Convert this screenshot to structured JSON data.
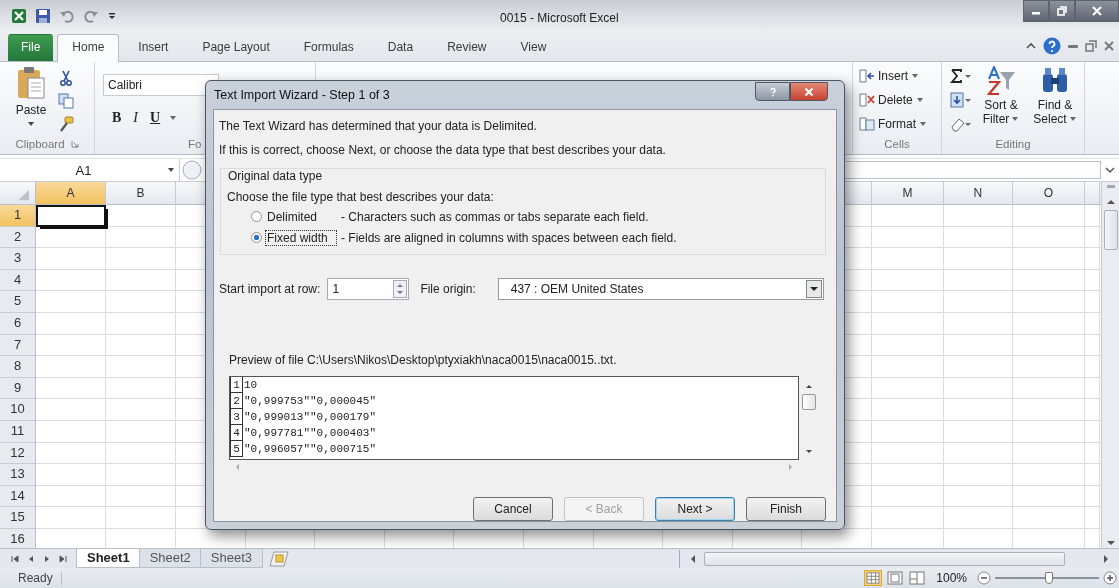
{
  "window": {
    "title": "0015 - Microsoft Excel"
  },
  "ribbon_tabs": [
    {
      "label": "File",
      "kind": "file",
      "selected": false
    },
    {
      "label": "Home",
      "kind": "tab",
      "selected": true
    },
    {
      "label": "Insert",
      "kind": "tab",
      "selected": false
    },
    {
      "label": "Page Layout",
      "kind": "tab",
      "selected": false
    },
    {
      "label": "Formulas",
      "kind": "tab",
      "selected": false
    },
    {
      "label": "Data",
      "kind": "tab",
      "selected": false
    },
    {
      "label": "Review",
      "kind": "tab",
      "selected": false
    },
    {
      "label": "View",
      "kind": "tab",
      "selected": false
    }
  ],
  "ribbon": {
    "clipboard": {
      "paste": "Paste",
      "label": "Clipboard"
    },
    "font": {
      "font_name": "Calibri",
      "bold": "B",
      "italic": "I",
      "underline": "U",
      "label": "Fo"
    },
    "cells": {
      "commands": [
        "Insert",
        "Delete",
        "Format"
      ],
      "label": "Cells"
    },
    "editing": {
      "sort": "Sort & Filter",
      "find": "Find & Select",
      "label": "Editing"
    }
  },
  "name_box": "A1",
  "sheet": {
    "columns": [
      {
        "label": "A",
        "selected": true
      },
      {
        "label": "B",
        "selected": false
      },
      {
        "label": "M",
        "selected": false
      },
      {
        "label": "N",
        "selected": false
      },
      {
        "label": "O",
        "selected": false
      }
    ],
    "rows": [
      {
        "label": "1",
        "selected": true
      },
      {
        "label": "2",
        "selected": false
      },
      {
        "label": "3",
        "selected": false
      },
      {
        "label": "4",
        "selected": false
      },
      {
        "label": "5",
        "selected": false
      },
      {
        "label": "6",
        "selected": false
      },
      {
        "label": "7",
        "selected": false
      },
      {
        "label": "8",
        "selected": false
      },
      {
        "label": "9",
        "selected": false
      },
      {
        "label": "10",
        "selected": false
      },
      {
        "label": "11",
        "selected": false
      },
      {
        "label": "12",
        "selected": false
      },
      {
        "label": "13",
        "selected": false
      },
      {
        "label": "14",
        "selected": false
      },
      {
        "label": "15",
        "selected": false
      },
      {
        "label": "16",
        "selected": false
      }
    ]
  },
  "sheet_tabs": [
    {
      "label": "Sheet1",
      "selected": true
    },
    {
      "label": "Sheet2",
      "selected": false
    },
    {
      "label": "Sheet3",
      "selected": false
    }
  ],
  "status_bar": {
    "text": "Ready",
    "zoom": "100%",
    "zoom_slider": {
      "level": 0.52
    }
  },
  "dialog": {
    "title": "Text Import Wizard - Step 1 of 3",
    "intro": [
      "The Text Wizard has determined that your data is Delimited.",
      "If this is correct, choose Next, or choose the data type that best describes your data."
    ],
    "group_title": "Original data type",
    "group_prompt": "Choose the file type that best describes your data:",
    "options": [
      {
        "label": "Delimited",
        "description": "- Characters such as commas or tabs separate each field.",
        "selected": false,
        "focused": false
      },
      {
        "label": "Fixed width",
        "description": "- Fields are aligned in columns with spaces between each field.",
        "selected": true,
        "focused": true
      }
    ],
    "start_row": {
      "label": "Start import at row:",
      "value": "1"
    },
    "file_origin": {
      "label": "File origin:",
      "value": "437 : OEM United States"
    },
    "preview": {
      "label": "Preview of file C:\\Users\\Nikos\\Desktop\\ptyxiakh\\naca0015\\naca0015..txt.",
      "lines": [
        {
          "number": "1",
          "text": "10"
        },
        {
          "number": "2",
          "text": "\"0,999753\"\"0,000045\""
        },
        {
          "number": "3",
          "text": "\"0,999013\"\"0,000179\""
        },
        {
          "number": "4",
          "text": "\"0,997781\"\"0,000403\""
        },
        {
          "number": "5",
          "text": "\"0,996057\"\"0,000715\""
        }
      ]
    },
    "buttons": [
      {
        "label": "Cancel",
        "disabled": false,
        "default": false
      },
      {
        "label": "< Back",
        "disabled": true,
        "default": false
      },
      {
        "label": "Next >",
        "disabled": false,
        "default": true
      },
      {
        "label": "Finish",
        "disabled": false,
        "default": false
      }
    ]
  }
}
